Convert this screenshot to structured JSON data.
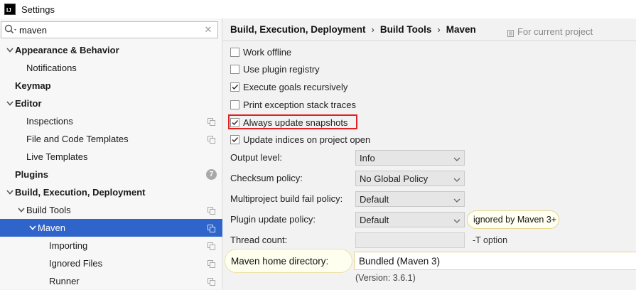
{
  "window": {
    "title": "Settings",
    "app_icon_text": "IJ"
  },
  "search": {
    "value": "maven",
    "placeholder": ""
  },
  "tree": [
    {
      "label": "Appearance & Behavior",
      "bold": true,
      "arrow": "down",
      "level": 0
    },
    {
      "label": "Notifications",
      "bold": false,
      "arrow": "",
      "level": 1
    },
    {
      "label": "Keymap",
      "bold": true,
      "arrow": "",
      "level": 0
    },
    {
      "label": "Editor",
      "bold": true,
      "arrow": "down",
      "level": 0
    },
    {
      "label": "Inspections",
      "bold": false,
      "arrow": "",
      "level": 1,
      "copy_icon": true
    },
    {
      "label": "File and Code Templates",
      "bold": false,
      "arrow": "",
      "level": 1,
      "copy_icon": true
    },
    {
      "label": "Live Templates",
      "bold": false,
      "arrow": "",
      "level": 1
    },
    {
      "label": "Plugins",
      "bold": true,
      "arrow": "",
      "level": 0,
      "badge": "7"
    },
    {
      "label": "Build, Execution, Deployment",
      "bold": true,
      "arrow": "down",
      "level": 0
    },
    {
      "label": "Build Tools",
      "bold": false,
      "arrow": "down",
      "level": 1,
      "copy_icon": true
    },
    {
      "label": "Maven",
      "bold": false,
      "arrow": "down",
      "level": 2,
      "copy_icon": true,
      "selected": true
    },
    {
      "label": "Importing",
      "bold": false,
      "arrow": "",
      "level": 3,
      "copy_icon": true
    },
    {
      "label": "Ignored Files",
      "bold": false,
      "arrow": "",
      "level": 3,
      "copy_icon": true
    },
    {
      "label": "Runner",
      "bold": false,
      "arrow": "",
      "level": 3,
      "copy_icon": true
    }
  ],
  "header": {
    "breadcrumb": [
      "Build, Execution, Deployment",
      "Build Tools",
      "Maven"
    ],
    "separator": "›",
    "scope": "For current project"
  },
  "checkboxes": [
    {
      "label": "Work offline",
      "checked": false
    },
    {
      "label": "Use plugin registry",
      "checked": false
    },
    {
      "label": "Execute goals recursively",
      "checked": true
    },
    {
      "label": "Print exception stack traces",
      "checked": false
    },
    {
      "label": "Always update snapshots",
      "checked": true,
      "highlighted": true
    },
    {
      "label": "Update indices on project open",
      "checked": true
    }
  ],
  "fields": {
    "output_level": {
      "label": "Output level:",
      "value": "Info"
    },
    "checksum_policy": {
      "label": "Checksum policy:",
      "value": "No Global Policy"
    },
    "multiproject_fail_policy": {
      "label": "Multiproject build fail policy:",
      "value": "Default"
    },
    "plugin_update_policy": {
      "label": "Plugin update policy:",
      "value": "Default",
      "note": "ignored by Maven 3+"
    },
    "thread_count": {
      "label": "Thread count:",
      "value": "",
      "hint": "-T option"
    },
    "maven_home": {
      "label": "Maven home directory:",
      "value": "Bundled (Maven 3)",
      "version": "(Version: 3.6.1)"
    }
  },
  "colors": {
    "selection": "#2f65ca",
    "highlight_border": "#e02222",
    "tooltip_border": "#e6d691"
  }
}
